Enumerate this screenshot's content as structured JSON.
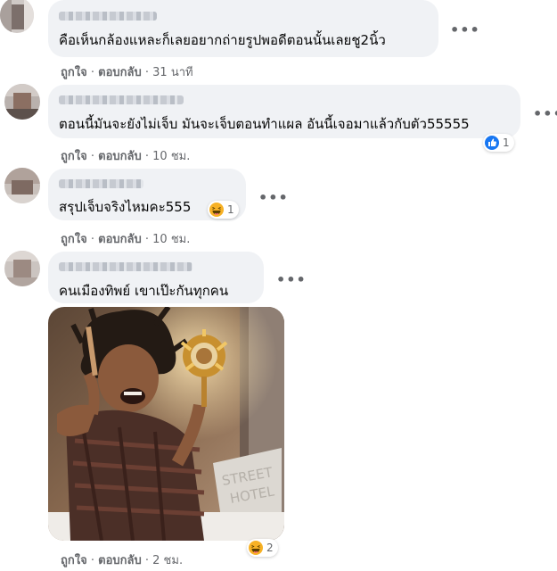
{
  "comments": [
    {
      "text": "คือเห็นกล้องแหละก็เลยอยากถ่ายรูปพอดีตอนนั้นเลยชู2นิ้ว",
      "like": "ถูกใจ",
      "sep": "·",
      "reply": "ตอบกลับ",
      "time": "31 นาที"
    },
    {
      "text": "ตอนนี้มันจะยังไม่เจ็บ มันจะเจ็บตอนทำแผล อันนี้เจอมาแล้วกับตัว55555",
      "like": "ถูกใจ",
      "sep": "·",
      "reply": "ตอบกลับ",
      "time": "10 ชม.",
      "reaction": {
        "icon": "like-icon",
        "count": "1"
      }
    },
    {
      "text": "สรุปเจ็บจริงไหมคะ555",
      "like": "ถูกใจ",
      "sep": "·",
      "reply": "ตอบกลับ",
      "time": "10 ชม.",
      "reaction": {
        "icon": "haha-icon",
        "count": "1"
      }
    },
    {
      "text": "คนเมืองทิพย์ เขาเป๊ะกันทุกคน",
      "like": "ถูกใจ",
      "sep": "·",
      "reply": "ตอบกลับ",
      "time": "2 ชม.",
      "reaction": {
        "icon": "haha-icon",
        "count": "2"
      },
      "photo_sign": {
        "line1": "STREET",
        "line2": "HOTEL"
      }
    }
  ],
  "more_icon": "more-options-icon",
  "colors": {
    "bubble": "#f0f2f5",
    "meta": "#65676b",
    "like_blue": "#1877f2",
    "haha_yellow": "#f7b125"
  }
}
